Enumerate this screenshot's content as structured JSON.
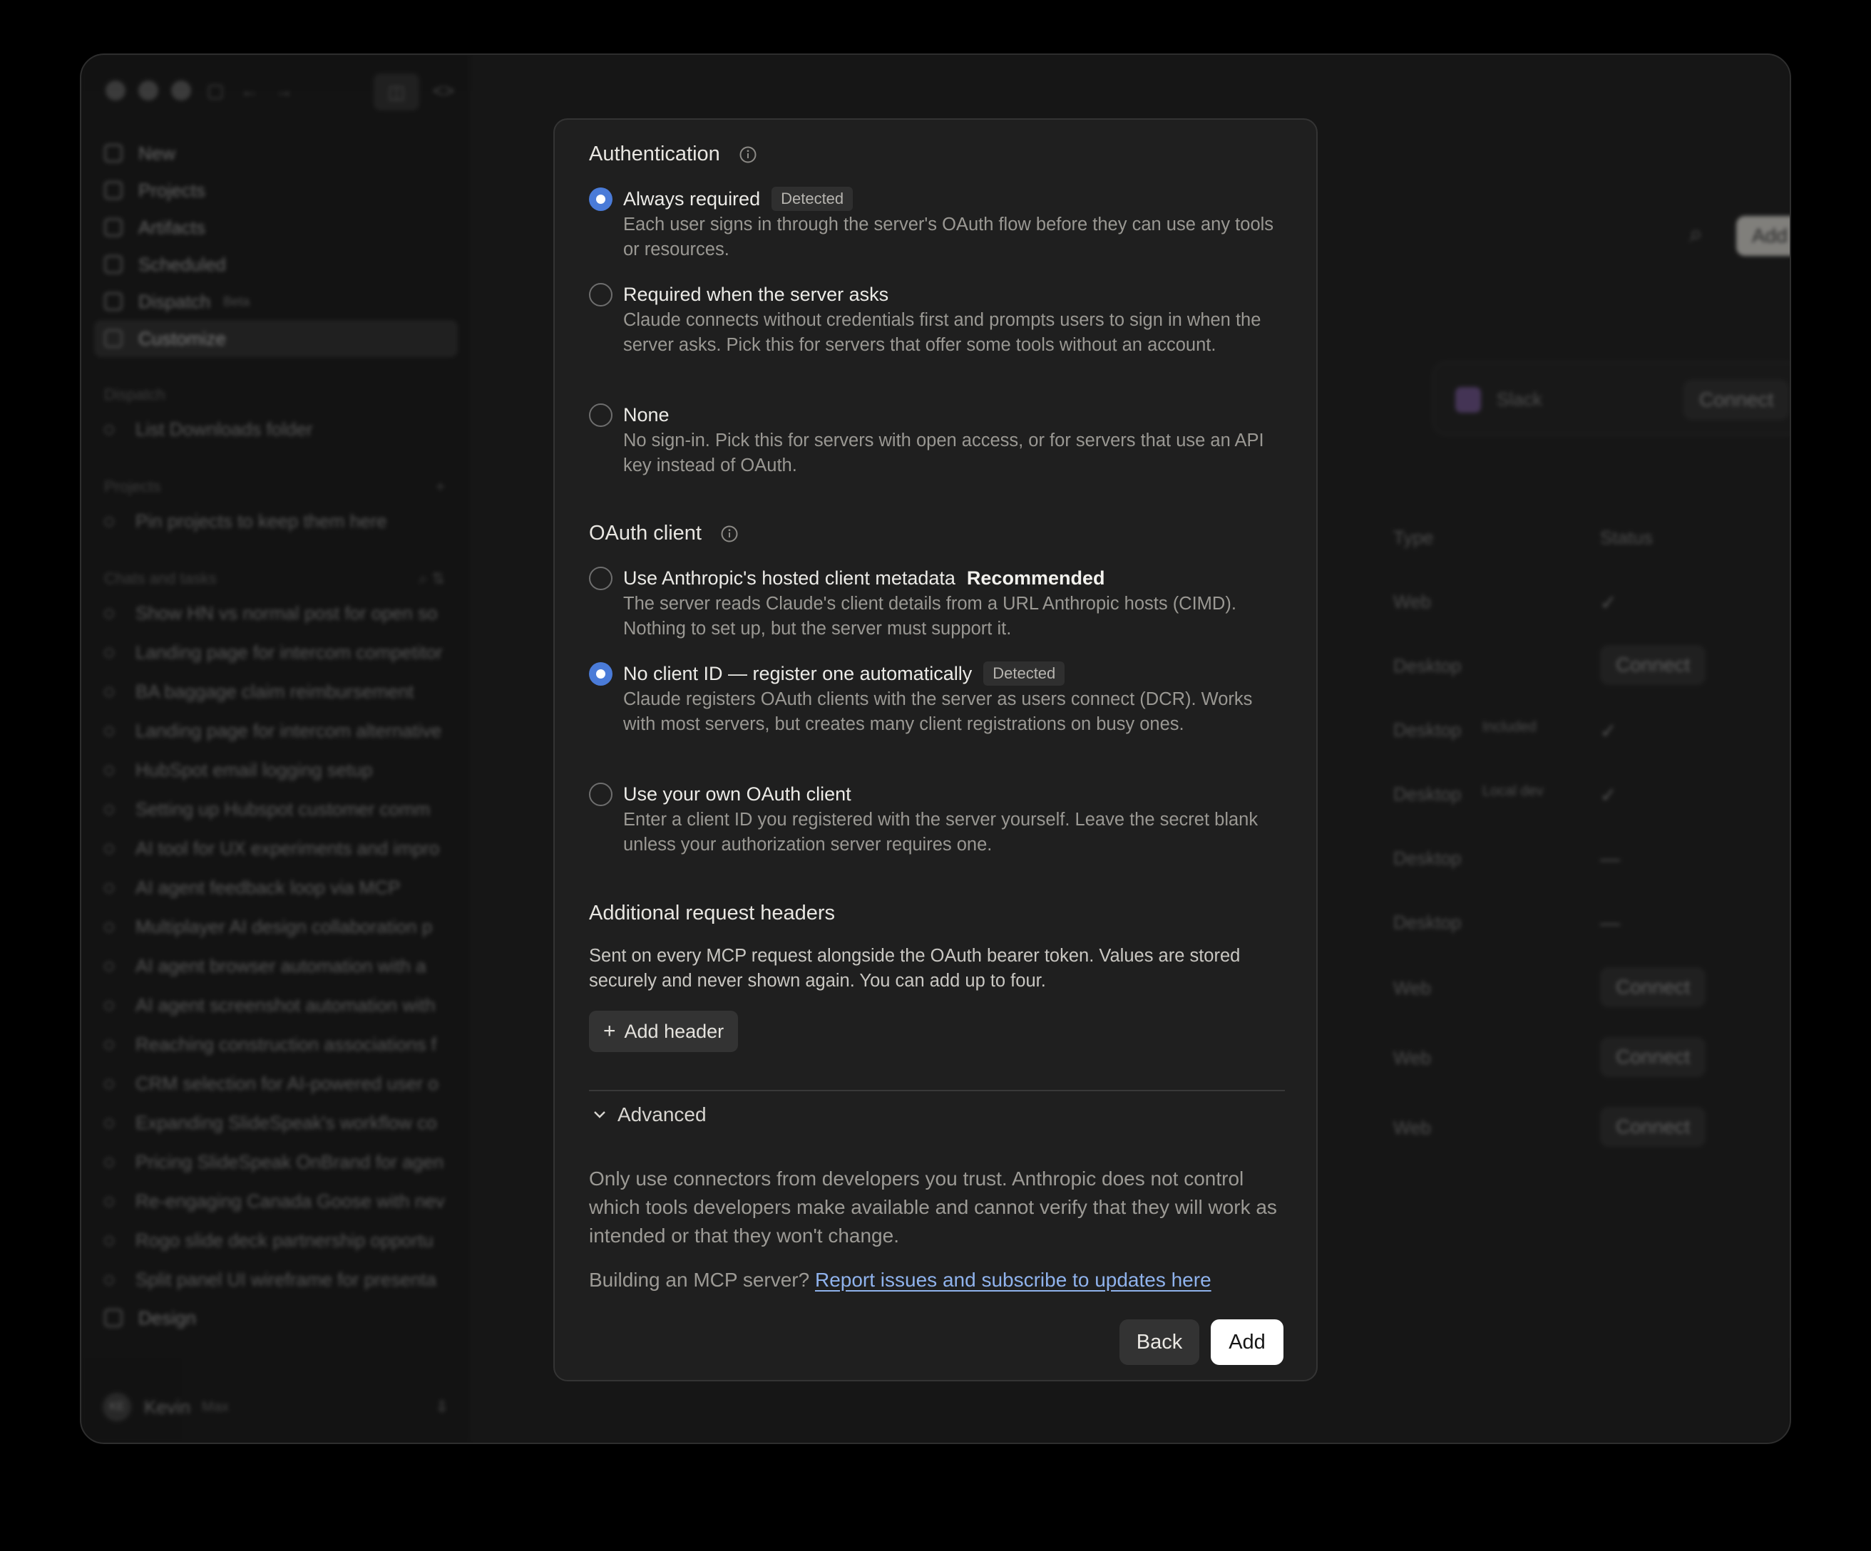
{
  "background": {
    "sidebar": {
      "nav": [
        {
          "label": "New"
        },
        {
          "label": "Projects"
        },
        {
          "label": "Artifacts"
        },
        {
          "label": "Scheduled"
        },
        {
          "label": "Dispatch",
          "badge": "Beta"
        },
        {
          "label": "Customize"
        }
      ],
      "dispatch_heading": "Dispatch",
      "dispatch_item": "List Downloads folder",
      "projects_heading": "Projects",
      "projects_placeholder": "Pin projects to keep them here",
      "chats_heading": "Chats and tasks",
      "chats": [
        "Show HN vs normal post for open so",
        "Landing page for intercom competitor",
        "BA baggage claim reimbursement",
        "Landing page for intercom alternative",
        "HubSpot email logging setup",
        "Setting up Hubspot customer comm",
        "AI tool for UX experiments and impro",
        "AI agent feedback loop via MCP",
        "Multiplayer AI design collaboration p",
        "AI agent browser automation with a",
        "AI agent screenshot automation with",
        "Reaching construction associations f",
        "CRM selection for AI-powered user o",
        "Expanding SlideSpeak's workflow co",
        "Pricing SlideSpeak OnBrand for agen",
        "Re-engaging Canada Goose with nev",
        "Rogo slide deck partnership opportu",
        "Split panel UI wireframe for presenta"
      ],
      "design_item": "Design",
      "user_name": "Kevin",
      "user_plan": "Max",
      "avatar_initials": "KE"
    },
    "main": {
      "add_button": "Add",
      "slack_label": "Slack",
      "connect_label": "Connect",
      "col_type": "Type",
      "col_status": "Status",
      "rows": [
        {
          "type": "Web",
          "status": "✓"
        },
        {
          "type": "Desktop",
          "status": "Connect"
        },
        {
          "type": "Desktop",
          "tag": "Included",
          "status": "✓"
        },
        {
          "type": "Desktop",
          "tag": "Local dev",
          "status": "✓"
        },
        {
          "type": "Desktop",
          "status": "—"
        },
        {
          "type": "Desktop",
          "status": "—"
        },
        {
          "type": "Web",
          "status": "Connect"
        },
        {
          "type": "Web",
          "status": "Connect"
        },
        {
          "type": "Web",
          "status": "Connect"
        }
      ]
    }
  },
  "modal": {
    "auth": {
      "title": "Authentication",
      "options": [
        {
          "label": "Always required",
          "badge": "Detected",
          "selected": true,
          "description": "Each user signs in through the server's OAuth flow before they can use any tools or resources."
        },
        {
          "label": "Required when the server asks",
          "selected": false,
          "description": "Claude connects without credentials first and prompts users to sign in when the server asks. Pick this for servers that offer some tools without an account."
        },
        {
          "label": "None",
          "selected": false,
          "description": "No sign-in. Pick this for servers with open access, or for servers that use an API key instead of OAuth."
        }
      ]
    },
    "oauth": {
      "title": "OAuth client",
      "options": [
        {
          "label": "Use Anthropic's hosted client metadata",
          "tag": "Recommended",
          "selected": false,
          "description": "The server reads Claude's client details from a URL Anthropic hosts (CIMD). Nothing to set up, but the server must support it."
        },
        {
          "label": "No client ID — register one automatically",
          "badge": "Detected",
          "selected": true,
          "description": "Claude registers OAuth clients with the server as users connect (DCR). Works with most servers, but creates many client registrations on busy ones."
        },
        {
          "label": "Use your own OAuth client",
          "selected": false,
          "description": "Enter a client ID you registered with the server yourself. Leave the secret blank unless your authorization server requires one."
        }
      ]
    },
    "headers": {
      "title": "Additional request headers",
      "description": "Sent on every MCP request alongside the OAuth bearer token. Values are stored securely and never shown again. You can add up to four.",
      "add_button": "Add header"
    },
    "advanced_label": "Advanced",
    "trust_text": "Only use connectors from developers you trust. Anthropic does not control which tools developers make available and cannot verify that they will work as intended or that they won't change.",
    "build_prefix": "Building an MCP server?",
    "build_link": "Report issues and subscribe to updates here",
    "back_button": "Back",
    "add_button": "Add",
    "colors": {
      "accent": "#4a7bd8",
      "link": "#8fb2ec",
      "surface": "#1f1f1f"
    }
  }
}
